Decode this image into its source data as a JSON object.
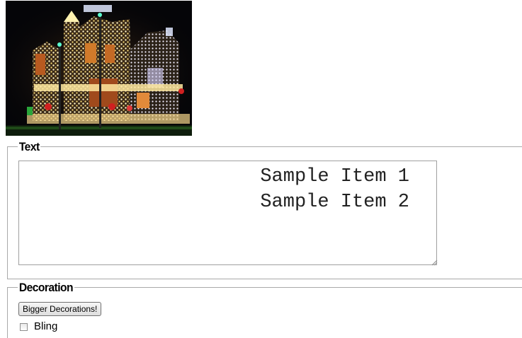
{
  "photo": {
    "icon": "christmas-lights-house-image"
  },
  "text_section": {
    "legend": "Text",
    "textarea_value": "Sample Item 1\nSample Item 2"
  },
  "decoration_section": {
    "legend": "Decoration",
    "button_label": "Bigger Decorations!",
    "checkbox_label": "Bling",
    "checkbox_checked": false
  }
}
